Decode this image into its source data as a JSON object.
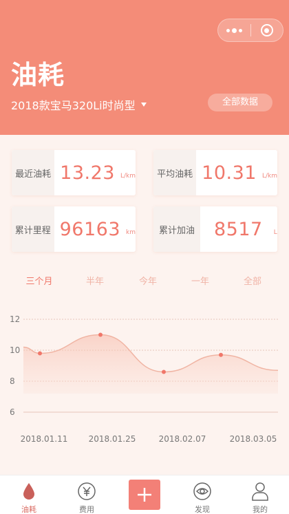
{
  "header": {
    "title": "油耗",
    "car_selector": "2018款宝马320Li时尚型",
    "all_data_button": "全部数据"
  },
  "stats": [
    {
      "label": "最近油耗",
      "value": "13.23",
      "unit": "L/km"
    },
    {
      "label": "平均油耗",
      "value": "10.31",
      "unit": "L/km"
    },
    {
      "label": "累计里程",
      "value": "96163",
      "unit": "km"
    },
    {
      "label": "累计加油",
      "value": "8517",
      "unit": "L"
    }
  ],
  "range_tabs": {
    "items": [
      "三个月",
      "半年",
      "今年",
      "一年",
      "全部"
    ],
    "active": "三个月"
  },
  "chart_data": {
    "type": "area",
    "x": [
      "2018.01.11",
      "2018.01.25",
      "2018.02.07",
      "2018.03.05"
    ],
    "tick_labels_x": [
      "2018.01.11",
      "2018.01.25",
      "2018.02.07",
      "2018.03.05"
    ],
    "series": [
      {
        "values": [
          9.8,
          11.0,
          8.6,
          9.7
        ]
      }
    ],
    "y_ticks": [
      6,
      8,
      10,
      12
    ],
    "ylim": [
      6,
      12
    ],
    "grid": true,
    "color": "#f0776a"
  },
  "tabbar": {
    "items": [
      {
        "label": "油耗",
        "icon": "drop-icon",
        "active": true
      },
      {
        "label": "费用",
        "icon": "yen-icon",
        "active": false
      },
      {
        "label": "",
        "icon": "plus-icon",
        "active": false
      },
      {
        "label": "发现",
        "icon": "eye-icon",
        "active": false
      },
      {
        "label": "我的",
        "icon": "person-icon",
        "active": false
      }
    ]
  },
  "colors": {
    "header": "#f48c78",
    "accent": "#f0776a",
    "background": "#fdf3ef"
  }
}
